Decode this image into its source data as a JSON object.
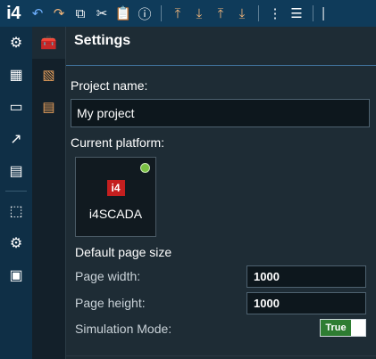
{
  "app": {
    "brand": "i4"
  },
  "toolbar": {
    "buttons": [
      {
        "name": "undo-button",
        "icon": "undo-icon",
        "glyph": "↶",
        "color": "#6fb0ff"
      },
      {
        "name": "redo-button",
        "icon": "redo-icon",
        "glyph": "↷",
        "color": "#f0b47a"
      },
      {
        "name": "copy-button",
        "icon": "copy-icon",
        "glyph": "⧉",
        "color": "#ffffff"
      },
      {
        "name": "cut-button",
        "icon": "cut-icon",
        "glyph": "✂",
        "color": "#ffffff"
      },
      {
        "name": "paste-button",
        "icon": "paste-icon",
        "glyph": "📋",
        "color": "#ffffff"
      },
      {
        "name": "info-button",
        "icon": "info-icon",
        "glyph": "ⓘ",
        "color": "#ffffff"
      },
      {
        "name": "align-top-button",
        "icon": "align-top-icon",
        "glyph": "⤒",
        "color": "#f2b57a"
      },
      {
        "name": "align-bottom-button",
        "icon": "align-bottom-icon",
        "glyph": "⤓",
        "color": "#f2b57a"
      },
      {
        "name": "align-top-alt-button",
        "icon": "align-top-alt-icon",
        "glyph": "⤒",
        "color": "#f2b57a"
      },
      {
        "name": "align-bottom-alt-button",
        "icon": "align-bottom-alt-icon",
        "glyph": "⤓",
        "color": "#f2b57a"
      },
      {
        "name": "distribute-horizontal-button",
        "icon": "distribute-horizontal-icon",
        "glyph": "⋮",
        "color": "#ffffff"
      },
      {
        "name": "distribute-vertical-button",
        "icon": "distribute-vertical-icon",
        "glyph": "☰",
        "color": "#ffffff"
      },
      {
        "name": "align-left-button",
        "icon": "align-left-icon",
        "glyph": "⎸",
        "color": "#ffffff"
      }
    ]
  },
  "nav": {
    "primary": [
      {
        "name": "rail-settings",
        "icon": "gear-icon",
        "glyph": "⚙"
      },
      {
        "name": "rail-dashboard",
        "icon": "dashboard-icon",
        "glyph": "▦"
      },
      {
        "name": "rail-monitor",
        "icon": "monitor-icon",
        "glyph": "▭"
      },
      {
        "name": "rail-trends",
        "icon": "trends-icon",
        "glyph": "↗"
      },
      {
        "name": "rail-reports",
        "icon": "reports-icon",
        "glyph": "▤"
      },
      {
        "name": "rail-packages",
        "icon": "package-upload-icon",
        "glyph": "⬚"
      },
      {
        "name": "rail-analytics",
        "icon": "analytics-settings-icon",
        "glyph": "⚙"
      },
      {
        "name": "rail-window",
        "icon": "window-icon",
        "glyph": "▣"
      }
    ],
    "secondary": [
      {
        "name": "rail2-toolbox",
        "icon": "toolbox-icon",
        "glyph": "🧰"
      },
      {
        "name": "rail2-widgets",
        "icon": "widgets-icon",
        "glyph": "▧"
      },
      {
        "name": "rail2-notes",
        "icon": "notes-icon",
        "glyph": "▤"
      }
    ]
  },
  "settings": {
    "title": "Settings",
    "project_name_label": "Project name:",
    "project_name_value": "My project",
    "current_platform_label": "Current platform:",
    "platform": {
      "logo_text": "i4",
      "name": "i4SCADA",
      "status_color": "#7ac143"
    },
    "default_page_size_label": "Default page size",
    "page_width_label": "Page width:",
    "page_width_value": "1000",
    "page_height_label": "Page height:",
    "page_height_value": "1000",
    "simulation_mode_label": "Simulation Mode:",
    "simulation_mode_value": "True"
  }
}
